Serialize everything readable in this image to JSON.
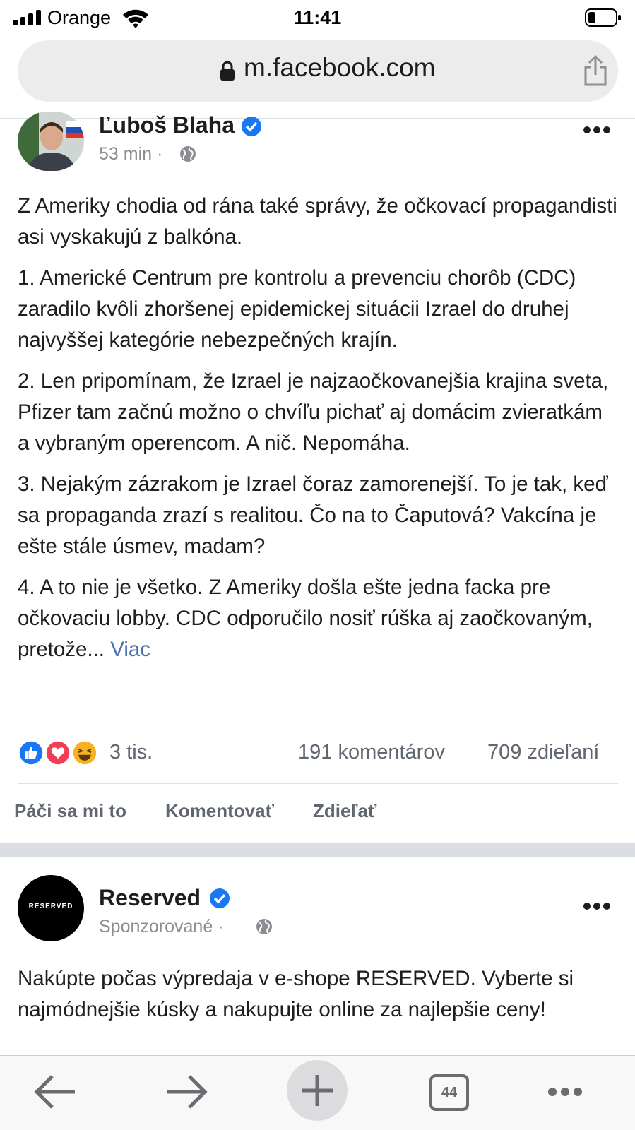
{
  "status_bar": {
    "carrier": "Orange",
    "time": "11:41",
    "icons": [
      "signal-icon",
      "wifi-icon",
      "battery-icon"
    ]
  },
  "browser": {
    "url": "m.facebook.com",
    "icons": [
      "lock-icon",
      "share-icon"
    ]
  },
  "post1": {
    "author": "Ľuboš Blaha",
    "verified": true,
    "time": "53 min",
    "separator": "·",
    "paragraphs": [
      "Z Ameriky chodia od rána také správy, že očkovací propagandisti asi vyskakujú z balkóna.",
      "1. Americké Centrum pre kontrolu a prevenciu chorôb (CDC) zaradilo kvôli zhoršenej epidemickej situácii Izrael do druhej najvyššej kategórie nebezpečných krajín.",
      "2. Len pripomínam, že Izrael je najzaočkovanejšia krajina sveta, Pfizer tam začnú možno o chvíľu pichať aj domácim zvieratkám a vybraným operencom. A nič. Nepomáha.",
      "3. Nejakým zázrakom je Izrael čoraz zamorenejší. To je tak, keď sa propaganda zrazí s realitou. Čo na to Čaputová? Vakcína je ešte stále úsmev, madam?"
    ],
    "last_paragraph": "4. A to nie je všetko. Z Ameriky došla ešte jedna facka pre očkovaciu lobby. CDC odporučilo nosiť rúška aj zaočkovaným, pretože...",
    "more_link": "Viac",
    "reactions_count": "3 tis.",
    "comments": "191 komentárov",
    "shares": "709 zdieľaní",
    "actions": {
      "like": "Páči sa mi to",
      "comment": "Komentovať",
      "share": "Zdieľať"
    }
  },
  "post2": {
    "author": "Reserved",
    "verified": true,
    "logo_text": "RESERVED",
    "label": "Sponzorované",
    "separator": "·",
    "text": "Nakúpte počas výpredaja v e-shope RESERVED. Vyberte si najmódnejšie kúsky a nakupujte online za najlepšie ceny!"
  },
  "toolbar": {
    "tab_count": "44",
    "icons": [
      "back-arrow-icon",
      "forward-arrow-icon",
      "plus-icon",
      "tabs-icon",
      "more-icon"
    ]
  },
  "colors": {
    "link": "#4b6ea8",
    "verified": "#1877f2",
    "like": "#1877f2",
    "love": "#f33e58",
    "haha": "#f7b125"
  }
}
